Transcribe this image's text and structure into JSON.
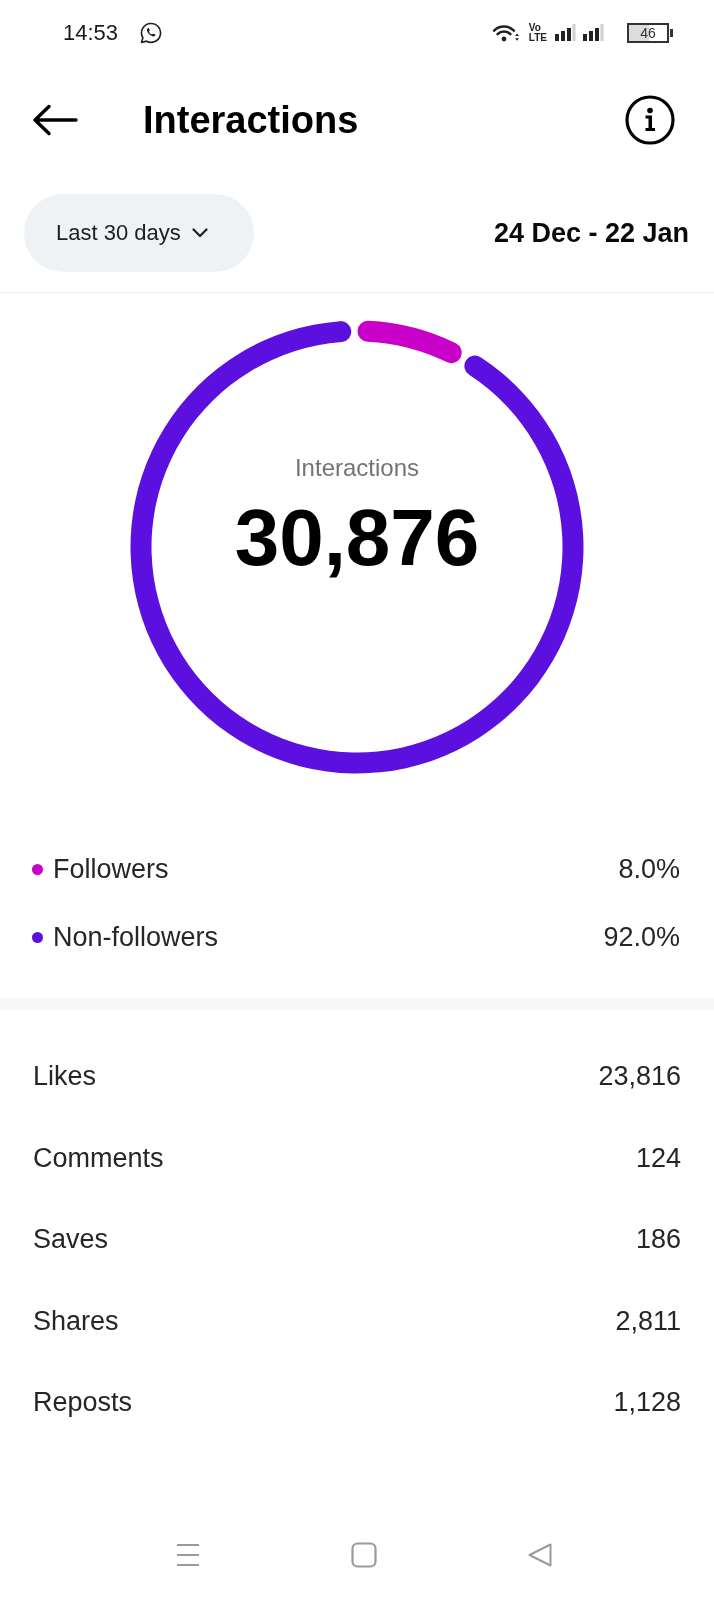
{
  "status_bar": {
    "time": "14:53",
    "network": [
      "Vo",
      "LTE"
    ],
    "battery": "46"
  },
  "header": {
    "title": "Interactions"
  },
  "filter": {
    "label": "Last 30 days",
    "date_range": "24 Dec - 22 Jan"
  },
  "summary": {
    "label": "Interactions",
    "total": "30,876",
    "chart_data": {
      "type": "donut",
      "categories": [
        "Followers",
        "Non-followers"
      ],
      "values": [
        8.0,
        92.0
      ]
    },
    "legend": [
      {
        "value": "8.0%",
        "color": "#c800c8"
      },
      {
        "value": "92.0%",
        "color": "#5b10df"
      }
    ]
  },
  "metrics": [
    {
      "label": "Likes",
      "value": "23,816"
    },
    {
      "label": "Comments",
      "value": "124"
    },
    {
      "label": "Saves",
      "value": "186"
    },
    {
      "label": "Shares",
      "value": "2,811"
    },
    {
      "label": "Reposts",
      "value": "1,128"
    }
  ]
}
